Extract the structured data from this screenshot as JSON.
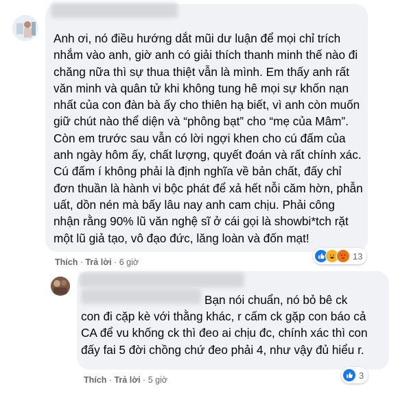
{
  "comment1": {
    "text": "Anh ơi, nó điều hướng dắt mũi dư luận để mọi chỉ trích nhắm vào anh, giờ anh có giải thích thanh minh thế nào đi chăng nữa thì sự thua thiệt vẫn là mình. Em thấy anh rất văn minh và quân tử khi không tung hê mọi sự khốn nạn nhất của con đàn bà ấy cho thiên hạ biết, vì anh còn muốn giữ chút nào thể diện và “phông bạt” cho “mẹ của Mâm”. Còn em trước sau vẫn có lời ngợi khen cho cú đấm của anh ngày hôm ấy, chất lượng, quyết đoán và rất chính xác. Cú đấm í không phải là định nghĩa về bản chất, đấy chỉ đơn thuần là hành vi bộc phát để xả hết nỗi căm hờn, phẫn uất, dồn nén mà bấy lâu nay anh cam chịu. Phải công nhận rằng 90% lũ văn nghệ sĩ ở cái gọi là showbi*tch rặt một lũ giả tạo, vô đạo đức, lăng loàn và đốn mạt!",
    "like_label": "Thích",
    "reply_label": "Trả lời",
    "time": "6 giờ",
    "reaction_count": "13",
    "reactions": [
      "like-icon",
      "haha-icon",
      "angry-icon"
    ]
  },
  "comment2": {
    "text_first": "Bạn nói chuẩn, nó bỏ bê ck",
    "text_rest": "con đi cặp kè với thằng khác, r cấm ck gặp con báo cả CA để vu khống ck thì đeo ai chịu đc, chính xác thì con đấy fai 5 đời chồng chứ đeo phải 4, như vậy đủ hiểu r.",
    "like_label": "Thích",
    "reply_label": "Trả lời",
    "time": "5 giờ",
    "reaction_count": "3",
    "reactions": [
      "like-icon"
    ]
  },
  "separator": "·"
}
